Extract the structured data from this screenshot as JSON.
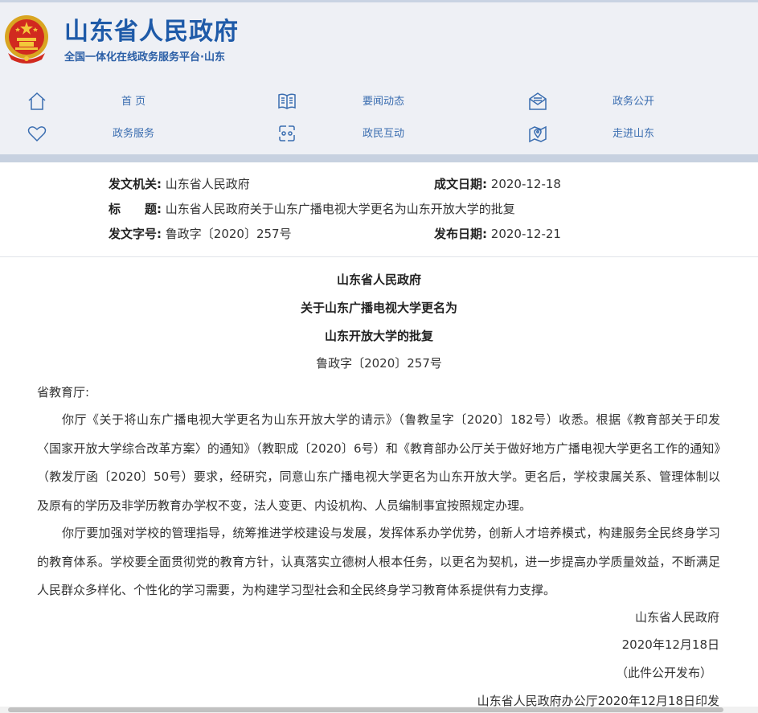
{
  "header": {
    "title": "山东省人民政府",
    "subtitle": "全国一体化在线政务服务平台·山东",
    "colors": {
      "brand": "#1e5aa8",
      "nav_text": "#3a6db0",
      "header_bg": "#eef0f5"
    }
  },
  "nav": [
    {
      "label": "首 页",
      "icon": "home-icon"
    },
    {
      "label": "要闻动态",
      "icon": "book-icon"
    },
    {
      "label": "政务公开",
      "icon": "mail-icon"
    },
    {
      "label": "政务服务",
      "icon": "heart-icon"
    },
    {
      "label": "政民互动",
      "icon": "interact-icon"
    },
    {
      "label": "走进山东",
      "icon": "map-pin-icon"
    }
  ],
  "meta": {
    "issuer_label": "发文机关:",
    "issuer": "山东省人民政府",
    "written_date_label": "成文日期:",
    "written_date": "2020-12-18",
    "title_label": "标　　题:",
    "title": "山东省人民政府关于山东广播电视大学更名为山东开放大学的批复",
    "doc_number_label": "发文字号:",
    "doc_number": "鲁政字〔2020〕257号",
    "publish_date_label": "发布日期:",
    "publish_date": "2020-12-21"
  },
  "document": {
    "heading_line1": "山东省人民政府",
    "heading_line2": "关于山东广播电视大学更名为",
    "heading_line3": "山东开放大学的批复",
    "doc_number": "鲁政字〔2020〕257号",
    "salutation": "省教育厅:",
    "paragraph1": "你厅《关于将山东广播电视大学更名为山东开放大学的请示》（鲁教呈字〔2020〕182号）收悉。根据《教育部关于印发〈国家开放大学综合改革方案〉的通知》（教职成〔2020〕6号）和《教育部办公厅关于做好地方广播电视大学更名工作的通知》（教发厅函〔2020〕50号）要求，经研究，同意山东广播电视大学更名为山东开放大学。更名后，学校隶属关系、管理体制以及原有的学历及非学历教育办学权不变，法人变更、内设机构、人员编制事宜按照规定办理。",
    "paragraph2": "你厅要加强对学校的管理指导，统筹推进学校建设与发展，发挥体系办学优势，创新人才培养模式，构建服务全民终身学习的教育体系。学校要全面贯彻党的教育方针，认真落实立德树人根本任务，以更名为契机，进一步提高办学质量效益，不断满足人民群众多样化、个性化的学习需要，为构建学习型社会和全民终身学习教育体系提供有力支撑。",
    "signature": "山东省人民政府",
    "sign_date": "2020年12月18日",
    "publish_note": "（此件公开发布）",
    "footer_line": "山东省人民政府办公厅2020年12月18日印发"
  }
}
